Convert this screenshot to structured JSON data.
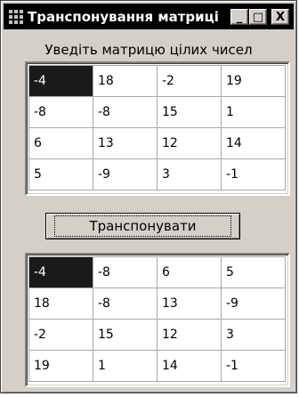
{
  "window": {
    "title": "Транспонування матриці"
  },
  "titlebar_buttons": {
    "minimize": "_",
    "maximize": "□",
    "close": "X"
  },
  "prompt": "Уведіть матрицю цілих чисел",
  "input_matrix": [
    [
      "-4",
      "18",
      "-2",
      "19"
    ],
    [
      "-8",
      "-8",
      "15",
      "1"
    ],
    [
      "6",
      "13",
      "12",
      "14"
    ],
    [
      "5",
      "-9",
      "3",
      "-1"
    ]
  ],
  "transpose_button": {
    "label": "Транспонувати"
  },
  "output_matrix": [
    [
      "-4",
      "-8",
      "6",
      "5"
    ],
    [
      "18",
      "-8",
      "13",
      "-9"
    ],
    [
      "-2",
      "15",
      "12",
      "3"
    ],
    [
      "19",
      "1",
      "14",
      "-1"
    ]
  ]
}
